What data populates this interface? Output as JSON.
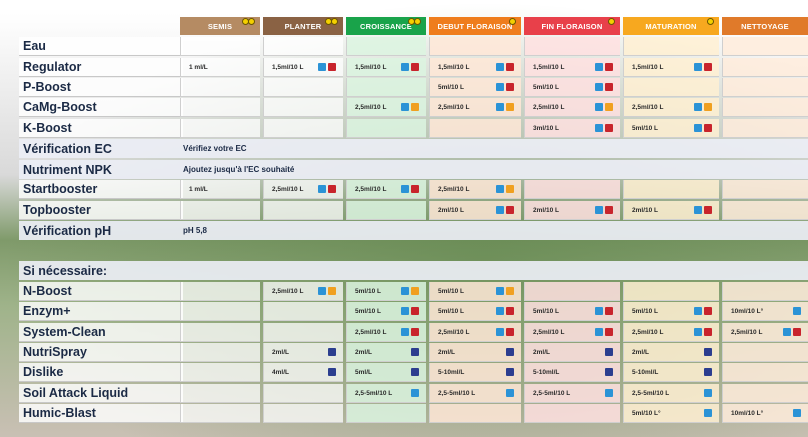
{
  "headers": [
    {
      "label": "SEMIS",
      "color": "#b58b63",
      "dots": 2
    },
    {
      "label": "PLANTER",
      "color": "#8a6244",
      "dots": 2
    },
    {
      "label": "CROISSANCE",
      "color": "#19a34a",
      "dots": 2
    },
    {
      "label": "DEBUT FLORAISON",
      "color": "#ef7d1d",
      "dots": 1
    },
    {
      "label": "FIN FLORAISON",
      "color": "#e8404a",
      "dots": 1
    },
    {
      "label": "MATURATION",
      "color": "#f7a81f",
      "dots": 1
    },
    {
      "label": "NETTOYAGE",
      "color": "#e07a2a",
      "dots": 0
    }
  ],
  "rows": [
    {
      "label": "Eau",
      "cells": [
        "",
        "",
        "",
        "",
        "",
        "",
        ""
      ]
    },
    {
      "label": "Regulator",
      "cells": [
        "1 ml/L",
        "1,5ml/10 L",
        "1,5ml/10 L",
        "1,5ml/10 L",
        "1,5ml/10 L",
        "1,5ml/10 L",
        ""
      ]
    },
    {
      "label": "P-Boost",
      "cells": [
        "",
        "",
        "",
        "5ml/10 L",
        "5ml/10 L",
        "",
        ""
      ]
    },
    {
      "label": "CaMg-Boost",
      "cells": [
        "",
        "",
        "2,5ml/10 L",
        "2,5ml/10 L",
        "2,5ml/10 L",
        "2,5ml/10 L",
        ""
      ]
    },
    {
      "label": "K-Boost",
      "cells": [
        "",
        "",
        "",
        "",
        "3ml/10 L",
        "5ml/10 L",
        ""
      ]
    },
    {
      "label": "Vérification EC",
      "wide": "Vérifiez votre EC"
    },
    {
      "label": "Nutriment NPK",
      "wide": "Ajoutez jusqu'à l'EC souhaité"
    },
    {
      "label": "Startbooster",
      "cells": [
        "1 ml/L",
        "2,5ml/10 L",
        "2,5ml/10 L",
        "2,5ml/10 L",
        "",
        "",
        ""
      ]
    },
    {
      "label": "Topbooster",
      "cells": [
        "",
        "",
        "",
        "2ml/10 L",
        "2ml/10 L",
        "2ml/10 L",
        ""
      ]
    },
    {
      "label": "Vérification pH",
      "wide": "pH 5,8"
    },
    {
      "label": "",
      "cells": []
    },
    {
      "label": "Si nécessaire:",
      "wide": ""
    },
    {
      "label": "N-Boost",
      "cells": [
        "",
        "2,5ml/10 L",
        "5ml/10 L",
        "5ml/10 L",
        "",
        "",
        ""
      ]
    },
    {
      "label": "Enzym+",
      "cells": [
        "",
        "",
        "5ml/10 L",
        "5ml/10 L",
        "5ml/10 L",
        "5ml/10 L",
        "10ml/10 L°"
      ]
    },
    {
      "label": "System-Clean",
      "cells": [
        "",
        "",
        "2,5ml/10 L",
        "2,5ml/10 L",
        "2,5ml/10 L",
        "2,5ml/10 L",
        "2,5ml/10 L"
      ]
    },
    {
      "label": "NutriSpray",
      "cells": [
        "",
        "2ml/L",
        "2ml/L",
        "2ml/L",
        "2ml/L",
        "2ml/L",
        ""
      ]
    },
    {
      "label": "Dislike",
      "cells": [
        "",
        "4ml/L",
        "5ml/L",
        "5-10ml/L",
        "5-10ml/L",
        "5-10ml/L",
        ""
      ]
    },
    {
      "label": "Soil Attack Liquid",
      "cells": [
        "",
        "",
        "2,5-5ml/10 L",
        "2,5-5ml/10 L",
        "2,5-5ml/10 L",
        "2,5-5ml/10 L",
        ""
      ]
    },
    {
      "label": "Humic-Blast",
      "cells": [
        "",
        "",
        "",
        "",
        "",
        "5ml/10 L°",
        "10ml/10 L°"
      ]
    }
  ],
  "colors": {
    "label": "#1b2a45",
    "accent_blue": "#2b93d6",
    "accent_red": "#c8242c",
    "accent_orange": "#f0a020",
    "accent_navy": "#2c3e8f"
  }
}
